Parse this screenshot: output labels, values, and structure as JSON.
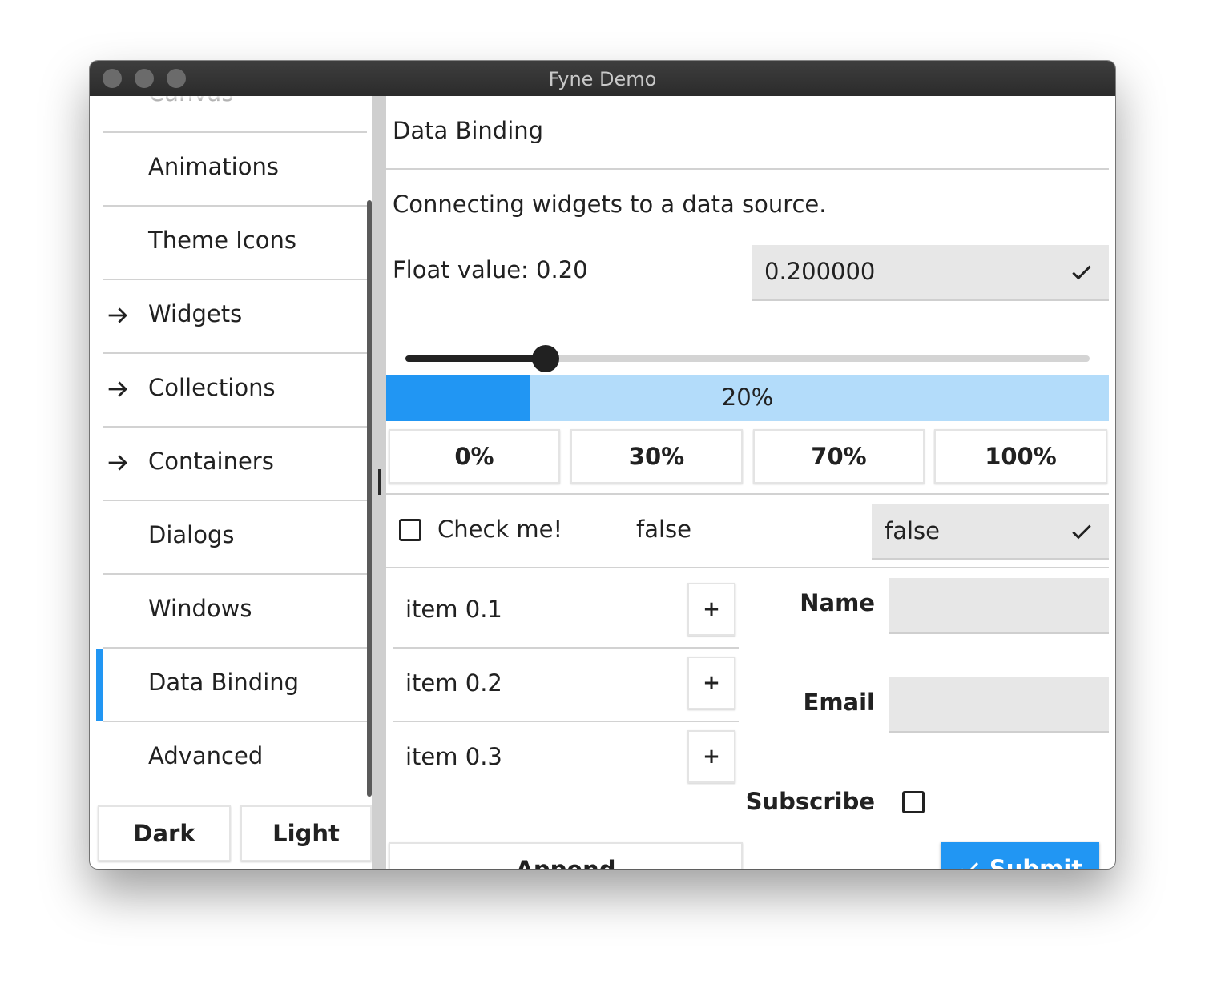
{
  "window": {
    "title": "Fyne Demo"
  },
  "sidebar": {
    "items": [
      {
        "label": "Canvas",
        "has_children": false,
        "selected": false
      },
      {
        "label": "Animations",
        "has_children": false,
        "selected": false
      },
      {
        "label": "Theme Icons",
        "has_children": false,
        "selected": false
      },
      {
        "label": "Widgets",
        "has_children": true,
        "selected": false
      },
      {
        "label": "Collections",
        "has_children": true,
        "selected": false
      },
      {
        "label": "Containers",
        "has_children": true,
        "selected": false
      },
      {
        "label": "Dialogs",
        "has_children": false,
        "selected": false
      },
      {
        "label": "Windows",
        "has_children": false,
        "selected": false
      },
      {
        "label": "Data Binding",
        "has_children": false,
        "selected": true
      },
      {
        "label": "Advanced",
        "has_children": false,
        "selected": false
      }
    ],
    "dark_label": "Dark",
    "light_label": "Light"
  },
  "main": {
    "title": "Data Binding",
    "description": "Connecting widgets to a data source.",
    "float_label": "Float value: 0.20",
    "float_entry": "0.200000",
    "slider_value": 0.2,
    "progress_value": 0.2,
    "progress_text": "20%",
    "preset_buttons": [
      "0%",
      "30%",
      "70%",
      "100%"
    ],
    "check_label": "Check me!",
    "check_state_text": "false",
    "check_entry": "false",
    "list_items": [
      "item 0.1",
      "item 0.2",
      "item 0.3"
    ],
    "add_label": "+",
    "append_label": "Append",
    "form": {
      "name_label": "Name",
      "email_label": "Email",
      "subscribe_label": "Subscribe",
      "submit_label": "Submit"
    }
  },
  "colors": {
    "accent": "#2196f3",
    "progress_track": "#b3dcfa",
    "entry_bg": "#e7e7e7"
  }
}
